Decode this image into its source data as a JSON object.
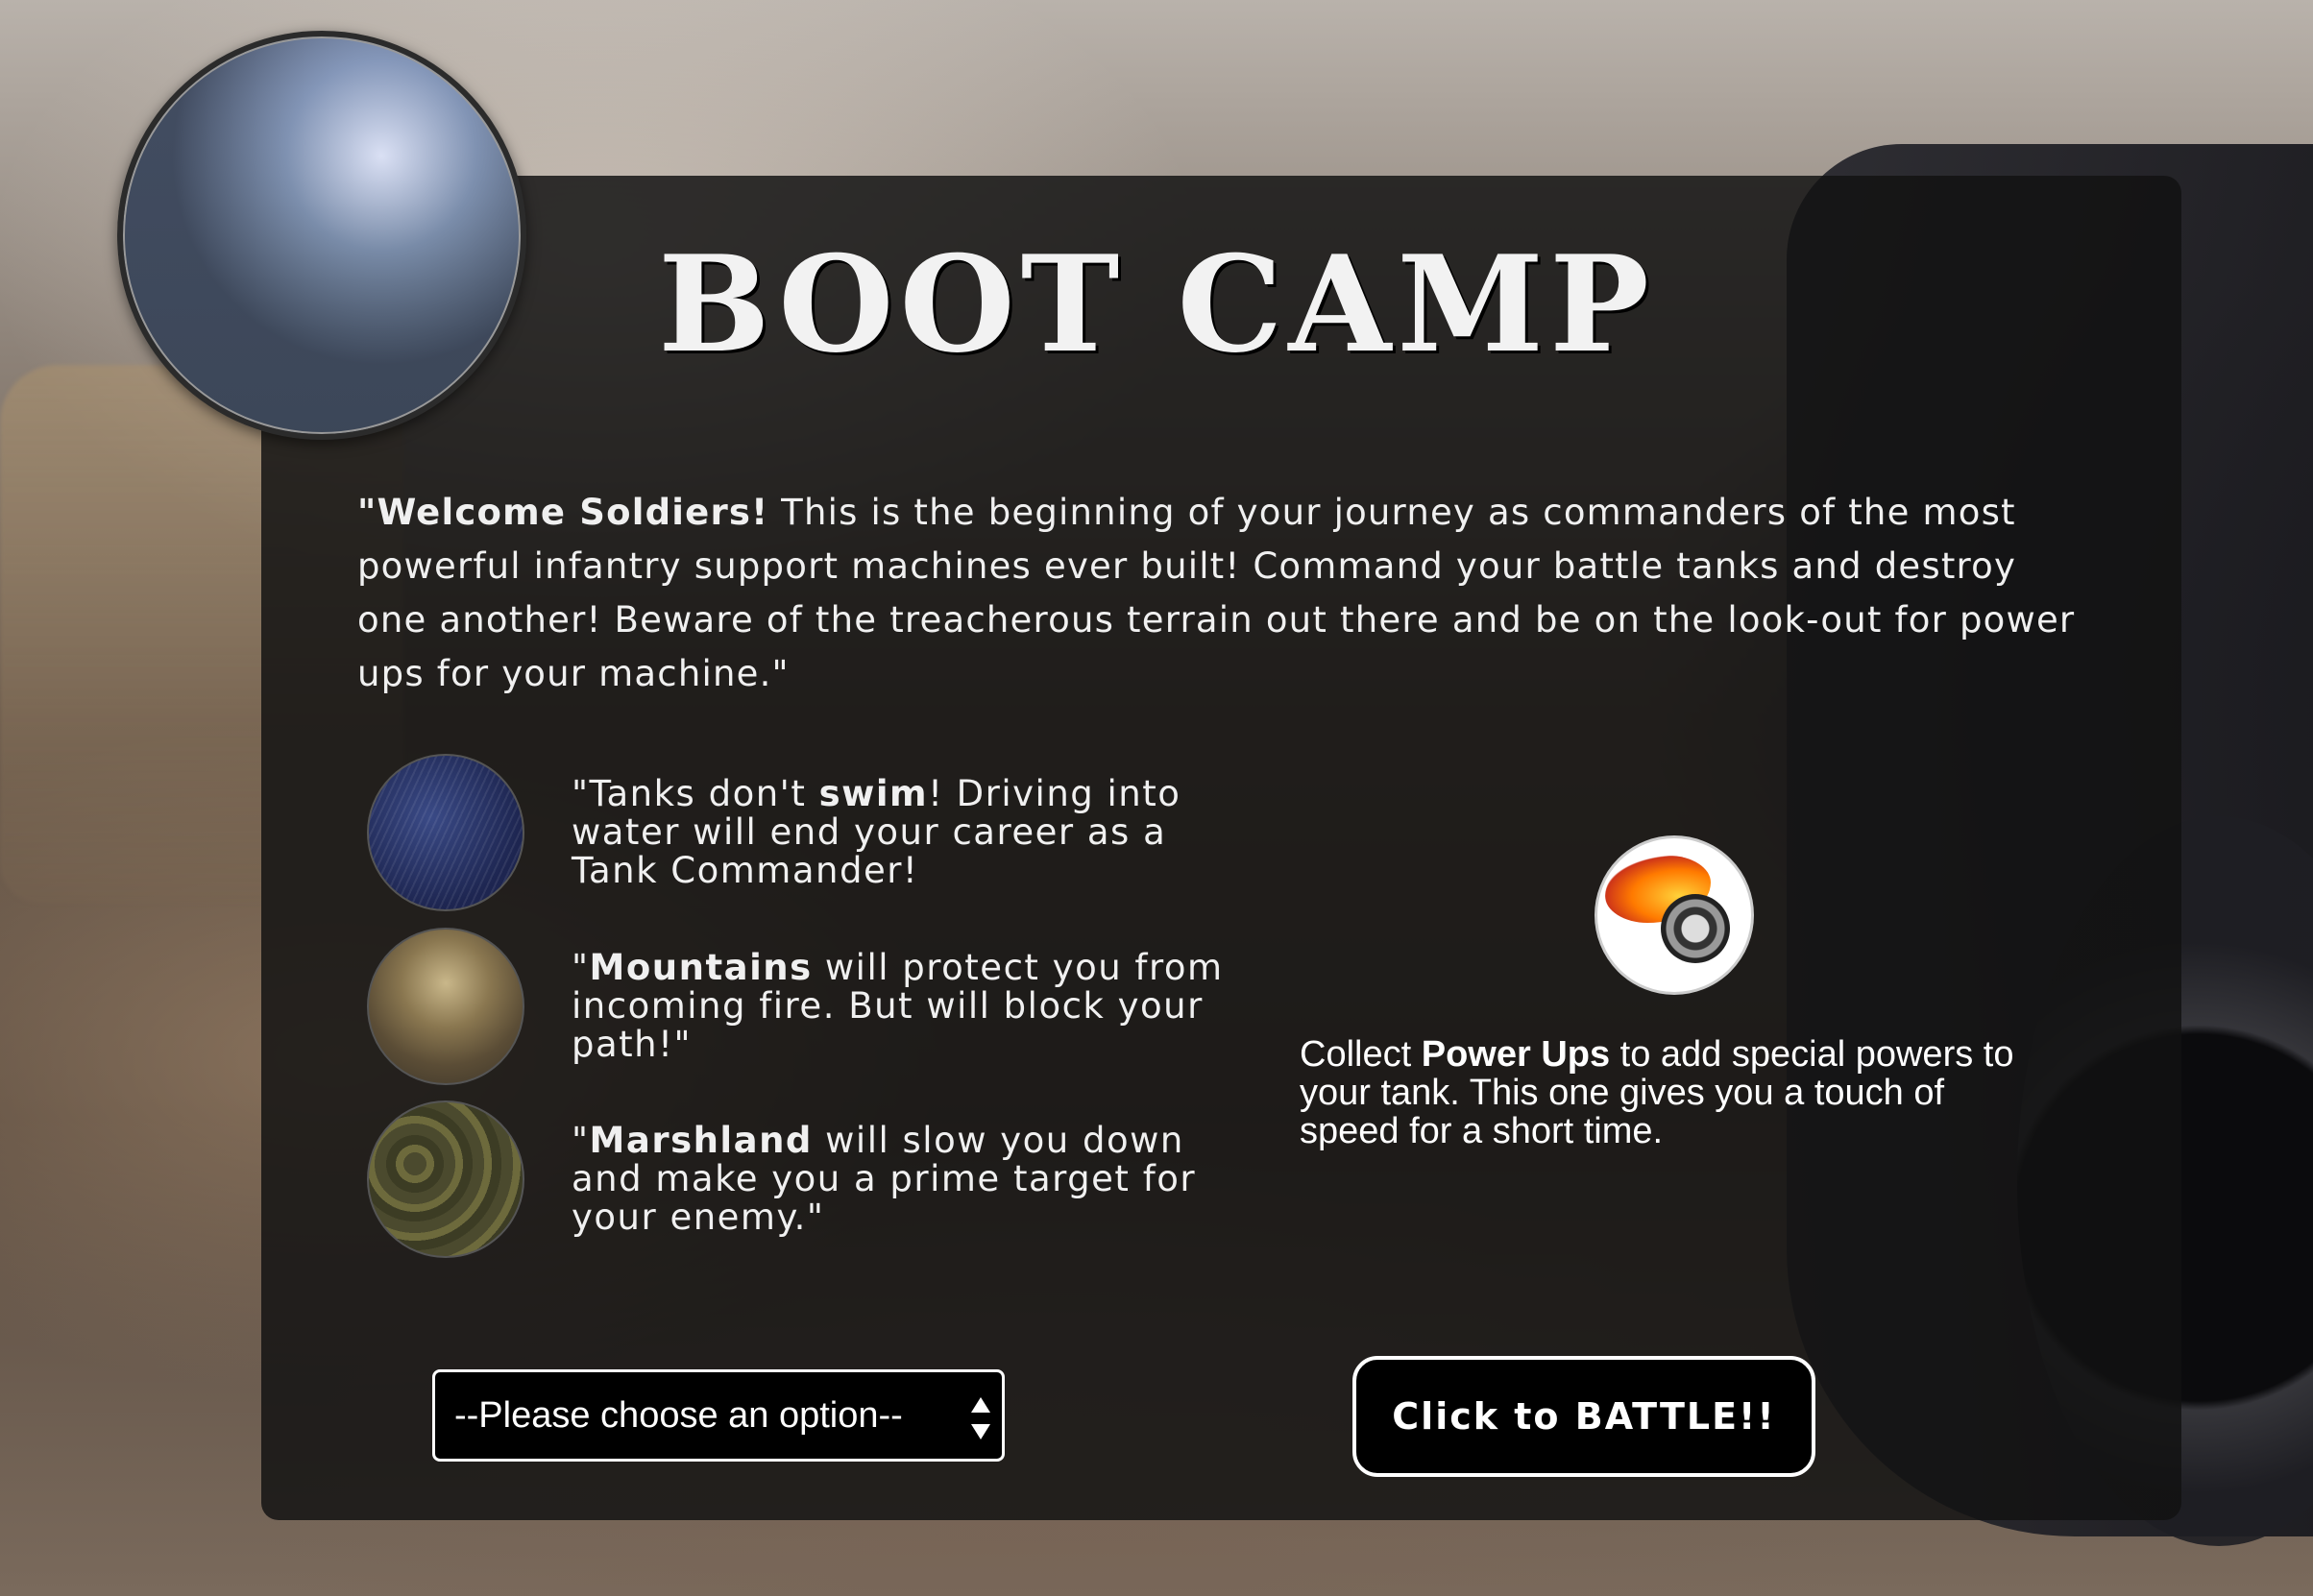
{
  "header": {
    "title": "BOOT CAMP"
  },
  "intro": {
    "lead": "\"Welcome Soldiers!",
    "body": " This is the beginning of your journey as commanders of the most powerful infantry support machines ever built! Command your battle tanks and destroy one another! Beware of the treacherous terrain out there and be on the look-out for power ups for your machine.\""
  },
  "tips": [
    {
      "icon": "water-terrain-icon",
      "before": "\"Tanks don't ",
      "bold": "swim",
      "after": "! Driving into water will end your career as a Tank Commander!"
    },
    {
      "icon": "mountain-terrain-icon",
      "before": "\"",
      "bold": "Mountains",
      "after": " will protect you from incoming fire. But will block your path!\""
    },
    {
      "icon": "marsh-terrain-icon",
      "before": "\"",
      "bold": "Marshland",
      "after": " will slow you down and make you a prime target for your enemy.\""
    }
  ],
  "powerup": {
    "icon": "flaming-wheel-icon",
    "before": "Collect ",
    "bold": "Power Ups",
    "after": " to add special powers to your tank. This one gives you a touch of speed for a short time."
  },
  "controls": {
    "select_value": "--Please choose an option--",
    "battle_label": "Click to BATTLE!!"
  },
  "colors": {
    "panel_bg": "#121212",
    "text": "#f0f0f0",
    "button_border": "#ffffff"
  }
}
